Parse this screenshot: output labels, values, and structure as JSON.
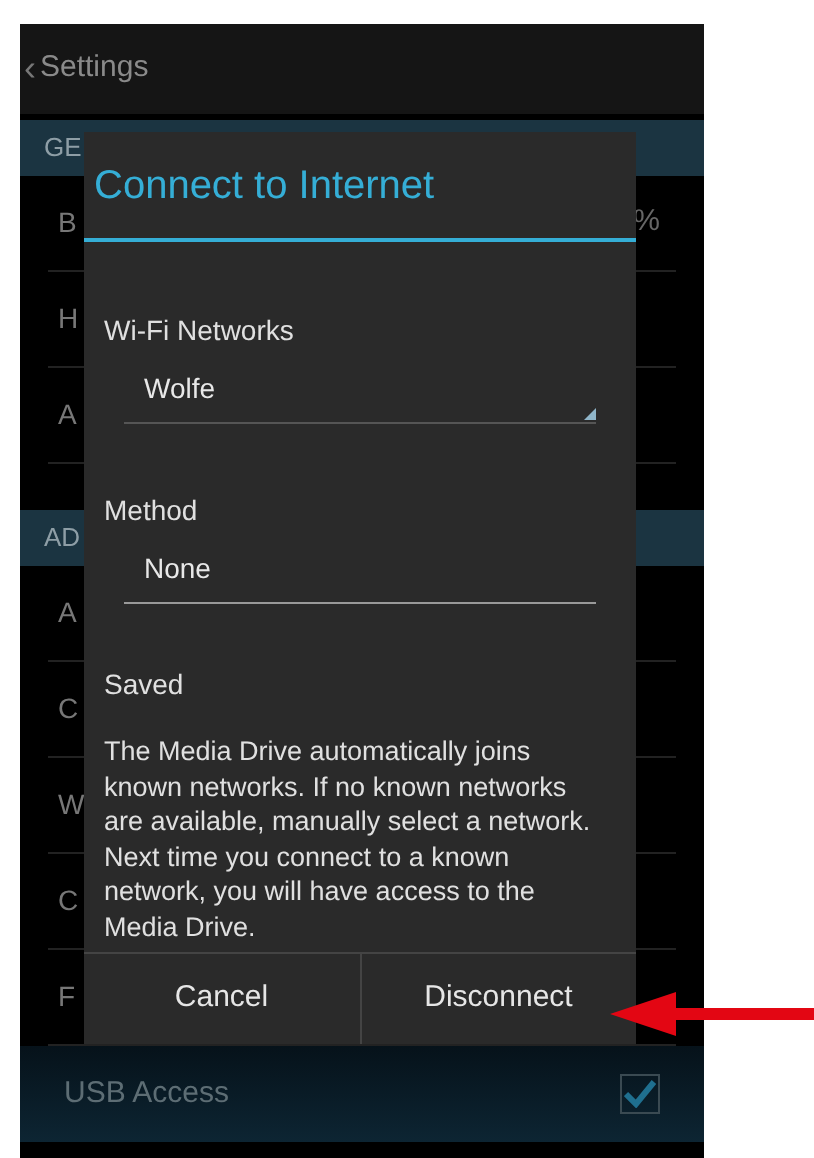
{
  "header": {
    "back_icon": "‹",
    "title": "Settings"
  },
  "settings": [
    {
      "kind": "section",
      "label": "GE"
    },
    {
      "kind": "row",
      "label": "B",
      "value": "%"
    },
    {
      "kind": "row",
      "label": "H"
    },
    {
      "kind": "row",
      "label": "A"
    },
    {
      "kind": "section",
      "label": "AD"
    },
    {
      "kind": "row",
      "label": "A"
    },
    {
      "kind": "row",
      "label": "C"
    },
    {
      "kind": "row",
      "label": "W"
    },
    {
      "kind": "row",
      "label": "C"
    },
    {
      "kind": "row",
      "label": "F"
    },
    {
      "kind": "check",
      "label": "USB Access",
      "checked": true
    }
  ],
  "dialog": {
    "title": "Connect to Internet",
    "fields": [
      {
        "kind": "dropdown",
        "label": "Wi-Fi Networks",
        "value": "Wolfe"
      },
      {
        "kind": "text",
        "label": "Method",
        "value": "None"
      }
    ],
    "status": "Saved",
    "message": "The Media Drive automatically joins known networks. If no known networks are available, manually select a network. Next time you connect to a known network, you will have access to the Media Drive.",
    "buttons": [
      "Cancel",
      "Disconnect"
    ]
  },
  "annotation": {
    "kind": "arrow"
  }
}
